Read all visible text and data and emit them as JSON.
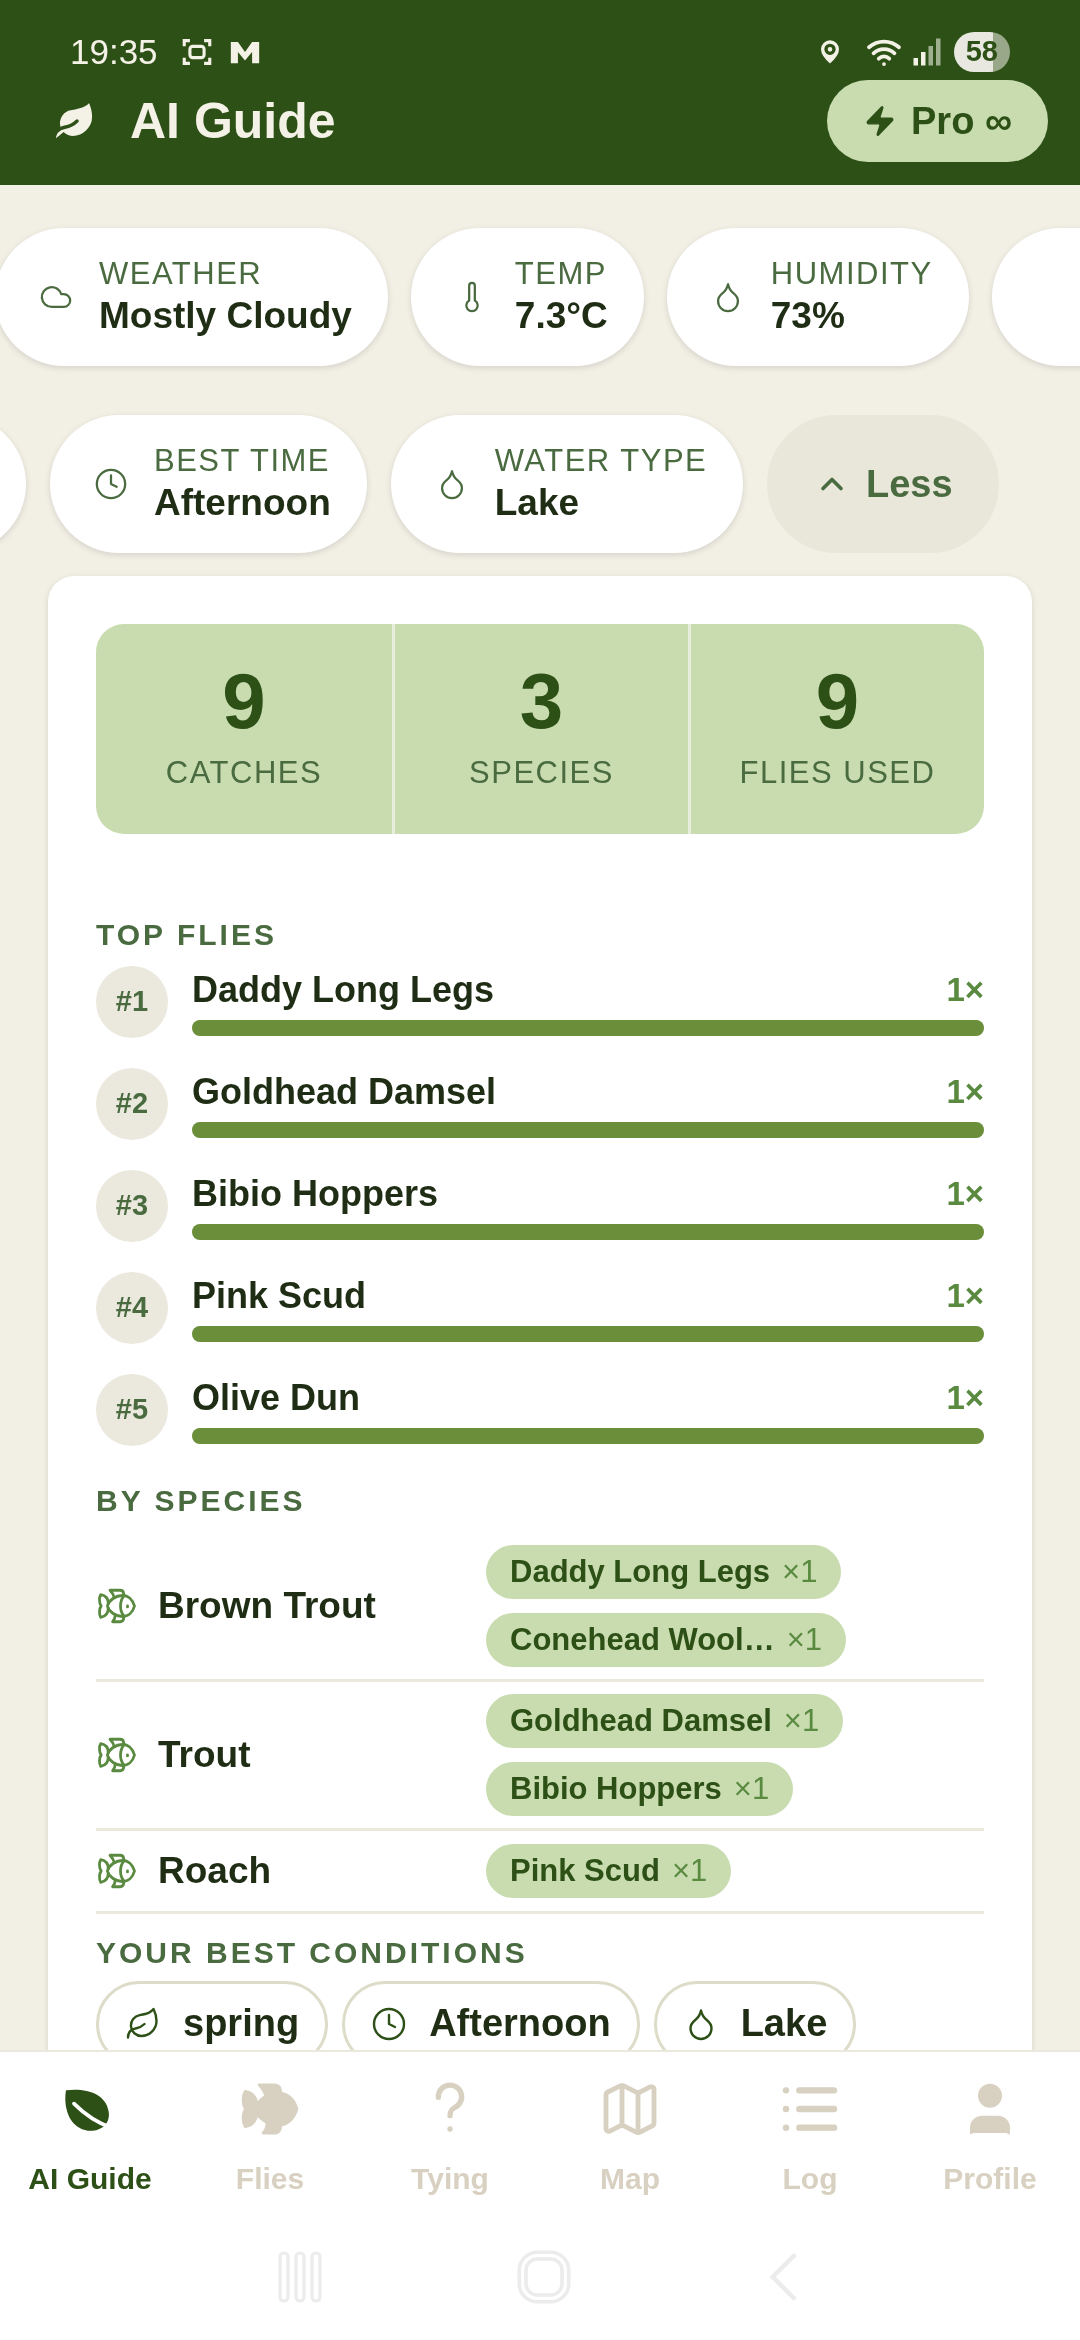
{
  "status_bar": {
    "time": "19:35",
    "battery": "58"
  },
  "header": {
    "title": "AI Guide",
    "pro_button": "Pro ∞"
  },
  "conditions": [
    {
      "kind": "weather",
      "label": "WEATHER",
      "value": "Mostly Cloudy"
    },
    {
      "kind": "temp",
      "label": "TEMP",
      "value": "7.3°C"
    },
    {
      "kind": "humidity",
      "label": "HUMIDITY",
      "value": "73%"
    }
  ],
  "details": [
    {
      "kind": "time",
      "label": "BEST TIME",
      "value": "Afternoon"
    },
    {
      "kind": "water",
      "label": "WATER TYPE",
      "value": "Lake"
    }
  ],
  "less_button": "Less",
  "stats": [
    {
      "value": "9",
      "label": "CATCHES"
    },
    {
      "value": "3",
      "label": "SPECIES"
    },
    {
      "value": "9",
      "label": "FLIES USED"
    }
  ],
  "top_flies": {
    "title": "TOP FLIES",
    "items": [
      {
        "rank": "#1",
        "name": "Daddy Long Legs",
        "count": "1×",
        "level": 1
      },
      {
        "rank": "#2",
        "name": "Goldhead Damsel",
        "count": "1×",
        "level": 1
      },
      {
        "rank": "#3",
        "name": "Bibio Hoppers",
        "count": "1×",
        "level": 1
      },
      {
        "rank": "#4",
        "name": "Pink Scud",
        "count": "1×",
        "level": 1
      },
      {
        "rank": "#5",
        "name": "Olive Dun",
        "count": "1×",
        "level": 1
      }
    ]
  },
  "by_species": {
    "title": "BY SPECIES",
    "rows": [
      {
        "name": "Brown Trout",
        "flies": [
          {
            "name": "Daddy Long Legs",
            "count": "×1"
          },
          {
            "name": "Conehead Wool…",
            "count": "×1"
          }
        ]
      },
      {
        "name": "Trout",
        "flies": [
          {
            "name": "Goldhead Damsel",
            "count": "×1"
          },
          {
            "name": "Bibio Hoppers",
            "count": "×1"
          }
        ]
      },
      {
        "name": "Roach",
        "flies": [
          {
            "name": "Pink Scud",
            "count": "×1"
          }
        ]
      }
    ]
  },
  "best_conditions": {
    "title": "YOUR BEST CONDITIONS",
    "chips": [
      {
        "kind": "season",
        "label": "spring"
      },
      {
        "kind": "time",
        "label": "Afternoon"
      },
      {
        "kind": "water",
        "label": "Lake"
      }
    ]
  },
  "nav": [
    {
      "label": "AI Guide",
      "selected": true
    },
    {
      "label": "Flies",
      "selected": false
    },
    {
      "label": "Tying",
      "selected": false
    },
    {
      "label": "Map",
      "selected": false
    },
    {
      "label": "Log",
      "selected": false
    },
    {
      "label": "Profile",
      "selected": false
    }
  ]
}
